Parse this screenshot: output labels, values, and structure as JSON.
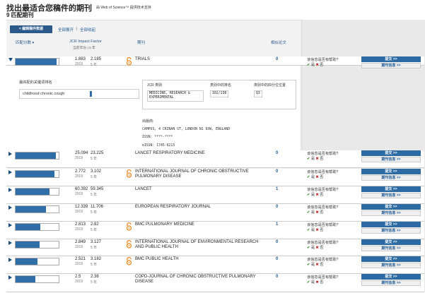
{
  "header": {
    "title": "找出最适合您稿件的期刊",
    "powered_by": "由 Web of Science™ 提供技术支持"
  },
  "match_count": "9 匹配期刊",
  "toolbar": {
    "edit_label": "< 编辑稿件数据",
    "expand_all": "全部展开",
    "separator": "|",
    "collapse_all": "全部收起"
  },
  "columns": {
    "match_score": "匹配分数",
    "jcr_if": "JCR Impact Factor",
    "jcr_if_sub": "当前年份 | 5 年",
    "journal": "期刊",
    "similar": "相似论文"
  },
  "common": {
    "year": "2019",
    "five_year": "5 年",
    "question": "该信息是否有帮助?",
    "yes": "是",
    "no": "否",
    "submit": "提交 >>",
    "journal_info": "期刊信息 >>"
  },
  "expanded": {
    "kw_label": "最匹配的关键词排名",
    "keyword": "childhood chronic cough",
    "jcr_headers": [
      "JCR 类别",
      "类别中的排名",
      "类别中的四分位位置"
    ],
    "jcr_category": "MEDICINE, RESEARCH & EXPERIMENTAL",
    "jcr_rank": "102/138",
    "jcr_quartile": "Q3",
    "publisher_label": "出版商:",
    "publisher": "CAMPUS, 4 CRINAN ST, LONDON N1 9XW, ENGLAND",
    "issn": "ISSN: ****-****",
    "eissn": "eISSN: 1745-6215"
  },
  "journals": [
    {
      "name": "TRIALS",
      "if": "1.883",
      "if5": "2.185",
      "score": 0.95,
      "similar": "0",
      "oa": true,
      "expanded": true
    },
    {
      "name": "LANCET RESPIRATORY MEDICINE",
      "if": "25.094",
      "if5": "23.225",
      "score": 0.93,
      "similar": "0",
      "oa": false
    },
    {
      "name": "INTERNATIONAL JOURNAL OF CHRONIC OBSTRUCTIVE PULMONARY DISEASE",
      "if": "2.772",
      "if5": "3.102",
      "score": 0.9,
      "similar": "0",
      "oa": true
    },
    {
      "name": "LANCET",
      "if": "60.392",
      "if5": "59.345",
      "score": 0.78,
      "similar": "1",
      "oa": false
    },
    {
      "name": "EUROPEAN RESPIRATORY JOURNAL",
      "if": "12.339",
      "if5": "11.706",
      "score": 0.7,
      "similar": "0",
      "oa": false
    },
    {
      "name": "BMC PULMONARY MEDICINE",
      "if": "2.813",
      "if5": "2.82",
      "score": 0.58,
      "similar": "1",
      "oa": true
    },
    {
      "name": "INTERNATIONAL JOURNAL OF ENVIRONMENTAL RESEARCH AND PUBLIC HEALTH",
      "if": "2.849",
      "if5": "3.127",
      "score": 0.55,
      "similar": "0",
      "oa": true
    },
    {
      "name": "BMC PUBLIC HEALTH",
      "if": "2.521",
      "if5": "3.182",
      "score": 0.5,
      "similar": "0",
      "oa": true
    },
    {
      "name": "COPD-JOURNAL OF CHRONIC OBSTRUCTIVE PULMONARY DISEASE",
      "if": "2.5",
      "if5": "2.38",
      "score": 0.46,
      "similar": "0",
      "oa": false
    }
  ]
}
